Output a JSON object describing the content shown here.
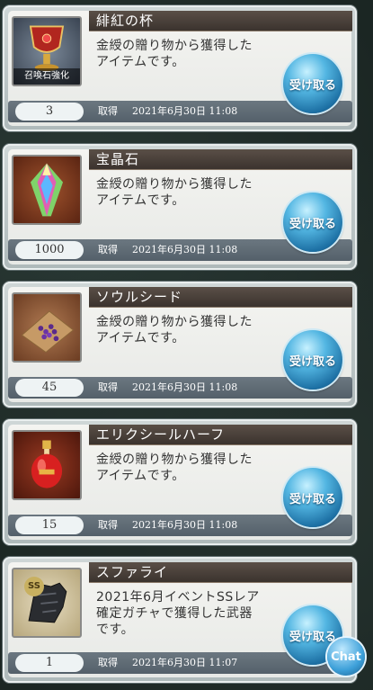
{
  "items": [
    {
      "name": "緋紅の杯",
      "description_line1": "金綬の贈り物から獲得した",
      "description_line2": "アイテムです。",
      "count": "3",
      "acquired_label": "取得",
      "acquired_date": "2021年6月30日 11:08",
      "thumb_caption": "召喚石強化",
      "receive_label": "受け取る",
      "icon": "chalice-icon"
    },
    {
      "name": "宝晶石",
      "description_line1": "金綬の贈り物から獲得した",
      "description_line2": "アイテムです。",
      "count": "1000",
      "acquired_label": "取得",
      "acquired_date": "2021年6月30日 11:08",
      "receive_label": "受け取る",
      "icon": "crystal-icon"
    },
    {
      "name": "ソウルシード",
      "description_line1": "金綬の贈り物から獲得した",
      "description_line2": "アイテムです。",
      "count": "45",
      "acquired_label": "取得",
      "acquired_date": "2021年6月30日 11:08",
      "receive_label": "受け取る",
      "icon": "seeds-icon"
    },
    {
      "name": "エリクシールハーフ",
      "description_line1": "金綬の贈り物から獲得した",
      "description_line2": "アイテムです。",
      "count": "15",
      "acquired_label": "取得",
      "acquired_date": "2021年6月30日 11:08",
      "receive_label": "受け取る",
      "icon": "elixir-bottle-icon"
    },
    {
      "name": "スファライ",
      "description_line1": "2021年6月イベントSSレア",
      "description_line2": "確定ガチャで獲得した武器",
      "description_line3": "です。",
      "count": "1",
      "acquired_label": "取得",
      "acquired_date": "2021年6月30日 11:07",
      "receive_label": "受け取る",
      "rarity_badge": "SS",
      "icon": "gauntlet-icon"
    }
  ],
  "chat_label": "Chat",
  "colors": {
    "title_bar": "#4a403a",
    "receive_button": "#2f8fc5",
    "card_background": "#eeefec"
  }
}
